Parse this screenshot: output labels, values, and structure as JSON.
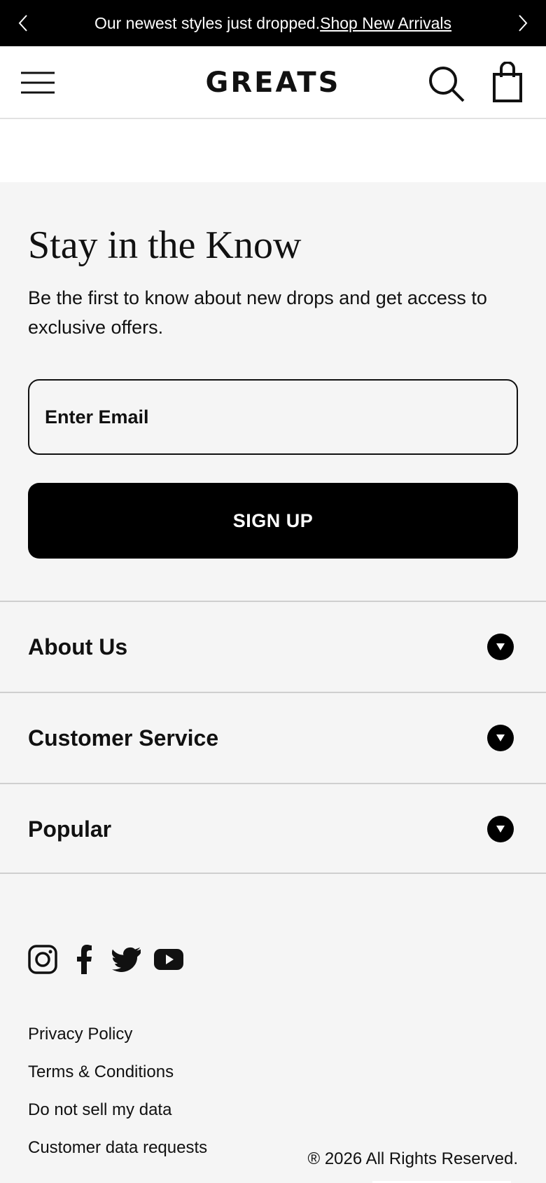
{
  "announcement": {
    "text": "Our newest styles just dropped.",
    "link": "Shop New Arrivals"
  },
  "header": {
    "logo": "GREATS"
  },
  "newsletter": {
    "title": "Stay in the Know",
    "description": "Be the first to know about new drops and get access to exclusive offers.",
    "email_placeholder": "Enter Email",
    "signup_label": "SIGN UP"
  },
  "footer_sections": [
    {
      "label": "About Us"
    },
    {
      "label": "Customer Service"
    },
    {
      "label": "Popular"
    }
  ],
  "socials": [
    "instagram-icon",
    "facebook-icon",
    "twitter-icon",
    "youtube-icon"
  ],
  "legal_links": [
    {
      "label": "Privacy Policy"
    },
    {
      "label": "Terms & Conditions"
    },
    {
      "label": "Do not sell my data"
    },
    {
      "label": "Customer data requests"
    }
  ],
  "copyright": "® 2026 All Rights Reserved.",
  "colors": {
    "background": "#f5f5f5",
    "accent": "#000000",
    "header_bg": "#ffffff"
  }
}
